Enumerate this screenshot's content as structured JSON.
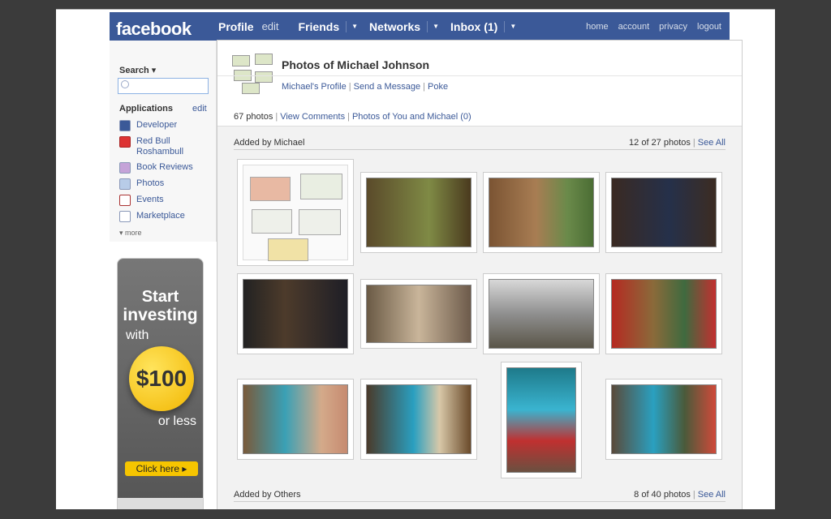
{
  "logo": "facebook",
  "nav": {
    "profile": "Profile",
    "edit": "edit",
    "friends": "Friends",
    "networks": "Networks",
    "inbox": "Inbox (1)",
    "right": [
      "home",
      "account",
      "privacy",
      "logout"
    ]
  },
  "sidebar": {
    "search_label": "Search ▾",
    "applications": "Applications",
    "apps_edit": "edit",
    "items": [
      {
        "label": "Developer",
        "icon": "developer-icon"
      },
      {
        "label": "Red Bull Roshambull",
        "icon": "redbull-icon"
      },
      {
        "label": "Book Reviews",
        "icon": "book-icon"
      },
      {
        "label": "Photos",
        "icon": "photos-icon"
      },
      {
        "label": "Events",
        "icon": "events-icon"
      },
      {
        "label": "Marketplace",
        "icon": "marketplace-icon"
      }
    ],
    "more": "▾ more"
  },
  "ad": {
    "line1": "Start",
    "line2": "investing",
    "line3": "with",
    "amount": "$100",
    "line4": "or less",
    "button": "Click here ▸"
  },
  "main": {
    "title": "Photos of Michael Johnson",
    "links": [
      "Michael's Profile",
      "Send a Message",
      "Poke"
    ],
    "count": "67 photos",
    "stat_links": [
      "View Comments",
      "Photos of You and Michael (0)"
    ]
  },
  "sections": [
    {
      "title": "Added by Michael",
      "count": "12 of 27 photos",
      "see_all": "See All"
    },
    {
      "title": "Added by Others",
      "count": "8 of 40 photos",
      "see_all": "See All"
    }
  ],
  "colors": {
    "brand": "#3b5998",
    "link": "#3b5998"
  }
}
